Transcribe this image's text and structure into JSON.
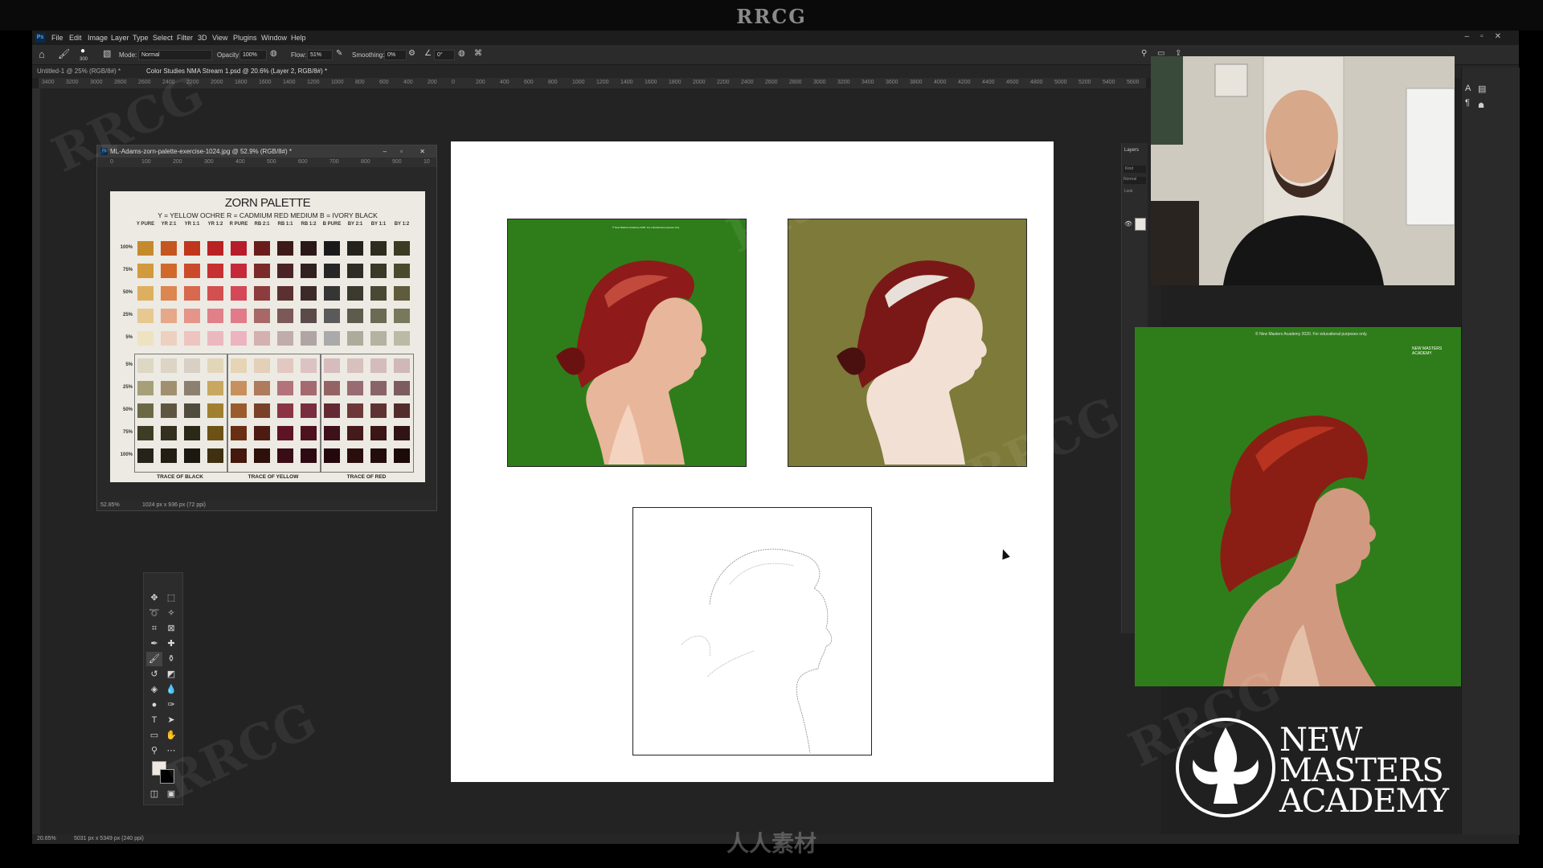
{
  "stream_banner": "RRCG",
  "bottom_watermark": "人人素材",
  "menu": [
    "File",
    "Edit",
    "Image",
    "Layer",
    "Type",
    "Select",
    "Filter",
    "3D",
    "View",
    "Plugins",
    "Window",
    "Help"
  ],
  "options": {
    "size": "300",
    "mode_label": "Mode:",
    "mode_value": "Normal",
    "opacity_label": "Opacity:",
    "opacity_value": "100%",
    "flow_label": "Flow:",
    "flow_value": "51%",
    "smoothing_label": "Smoothing:",
    "smoothing_value": "0%",
    "angle_value": "0°"
  },
  "tabs": [
    "Untitled-1 @ 25% (RGB/8#) *",
    "Color Studies NMA Stream 1.psd @ 20.6% (Layer 2, RGB/8#) *"
  ],
  "ruler_ticks": [
    "3400",
    "3200",
    "3000",
    "2800",
    "2600",
    "2400",
    "2200",
    "2000",
    "1800",
    "1600",
    "1400",
    "1200",
    "1000",
    "800",
    "600",
    "400",
    "200",
    "0",
    "200",
    "400",
    "600",
    "800",
    "1000",
    "1200",
    "1400",
    "1600",
    "1800",
    "2000",
    "2200",
    "2400",
    "2600",
    "2800",
    "3000",
    "3200",
    "3400",
    "3600",
    "3800",
    "4000",
    "4200",
    "4400",
    "4600",
    "4800",
    "5000",
    "5200",
    "5400",
    "5600"
  ],
  "status": {
    "zoom": "20.65%",
    "doc_size": "5031 px x 5349 px (240 ppi)"
  },
  "layers_panel": {
    "title": "Layers",
    "search": "Kind",
    "blend": "Normal",
    "lock": "Lock"
  },
  "palette_window": {
    "title": "ML-Adams-zorn-palette-exercise-1024.jpg @ 52.9% (RGB/8#) *",
    "ruler": [
      "0",
      "100",
      "200",
      "300",
      "400",
      "500",
      "600",
      "700",
      "800",
      "900",
      "10"
    ],
    "status_zoom": "52.85%",
    "status_size": "1024 px x 936 px (72 ppi)",
    "image_title": "ZORN PALETTE",
    "legend": "Y = YELLOW OCHRE   R = CADMIUM RED MEDIUM   B = IVORY BLACK",
    "columns": [
      "Y PURE",
      "YR 2:1",
      "YR 1:1",
      "YR 1:2",
      "R PURE",
      "RB 2:1",
      "RB 1:1",
      "RB 1:2",
      "B PURE",
      "BY 2:1",
      "BY 1:1",
      "BY 1:2"
    ],
    "top_rows": [
      "100%",
      "75%",
      "50%",
      "25%",
      "5%"
    ],
    "bottom_rows": [
      "5%",
      "25%",
      "50%",
      "75%",
      "100%"
    ],
    "group_labels": [
      "TRACE OF BLACK",
      "TRACE OF YELLOW",
      "TRACE OF RED"
    ],
    "colors": {
      "top": [
        [
          "#c68a2e",
          "#c4561f",
          "#c0361d",
          "#b82222",
          "#b71c2a",
          "#6a1c1c",
          "#3c1a18",
          "#2a1717",
          "#1a1a1a",
          "#23231c",
          "#2e2c1e",
          "#3c3a22"
        ],
        [
          "#d29a3c",
          "#cf6a2c",
          "#cc4a2c",
          "#c63030",
          "#c52a3a",
          "#7a2a2a",
          "#4a2424",
          "#312020",
          "#262626",
          "#2d2d24",
          "#3a3826",
          "#4c4a2c"
        ],
        [
          "#ddb060",
          "#dc8650",
          "#d8684e",
          "#d25050",
          "#d44858",
          "#8c3c3c",
          "#5c3030",
          "#3c2a2a",
          "#353535",
          "#3a3a2e",
          "#4a4834",
          "#5e5c3c"
        ],
        [
          "#e6c890",
          "#e6a888",
          "#e49488",
          "#e08088",
          "#e27a8a",
          "#a86868",
          "#7c5858",
          "#5a4a4a",
          "#5a5a5a",
          "#5c5c4c",
          "#6c6a54",
          "#7a785c"
        ],
        [
          "#efe2c2",
          "#eed0c0",
          "#eec4c0",
          "#ecb8c0",
          "#ecb4c0",
          "#d4b0b0",
          "#c0acac",
          "#b0a4a4",
          "#aaaaaa",
          "#acac9c",
          "#b4b2a0",
          "#bcbaa4"
        ]
      ],
      "bottom": [
        [
          "#dcd8c4",
          "#dcd4c4",
          "#d8d0c4",
          "#e2d6b8",
          "#e6d4b4",
          "#e4cfb8",
          "#e2c8c0",
          "#dcc2c0",
          "#d6bcbc",
          "#d8c0bc",
          "#d4bcbc",
          "#d0b8b8"
        ],
        [
          "#a6a078",
          "#a09070",
          "#8c8070",
          "#c8a860",
          "#c8905c",
          "#b07a5c",
          "#b4727a",
          "#a46a70",
          "#946464",
          "#986c70",
          "#886468",
          "#7c5c60"
        ],
        [
          "#6c6846",
          "#5e5640",
          "#524c3e",
          "#a08030",
          "#9a5c2c",
          "#7a4028",
          "#8a3444",
          "#782e3c",
          "#642a34",
          "#6e3838",
          "#5e3232",
          "#522c2c"
        ],
        [
          "#3e3c24",
          "#34301e",
          "#2c2818",
          "#6c5216",
          "#6a2e14",
          "#4c1c12",
          "#5e1424",
          "#4e121e",
          "#3e101a",
          "#441a1a",
          "#3a1616",
          "#301414"
        ],
        [
          "#26241a",
          "#221e14",
          "#1c1810",
          "#3e3010",
          "#44180c",
          "#2e100a",
          "#3a0c16",
          "#2e0a12",
          "#24080e",
          "#2a0e0e",
          "#220c0c",
          "#1c0a0a"
        ]
      ]
    }
  },
  "reference": {
    "caption": "© New Masters Academy 2020. For educational purposes only.",
    "logo": "NEW MASTERS ACADEMY"
  },
  "logo": {
    "line1": "NEW",
    "line2": "MASTERS",
    "line3": "ACADEMY"
  },
  "accent_colors": {
    "green_bg": "#2f7d1a",
    "olive_bg": "#7d7a3a",
    "hair_red": "#8f1a1a"
  }
}
